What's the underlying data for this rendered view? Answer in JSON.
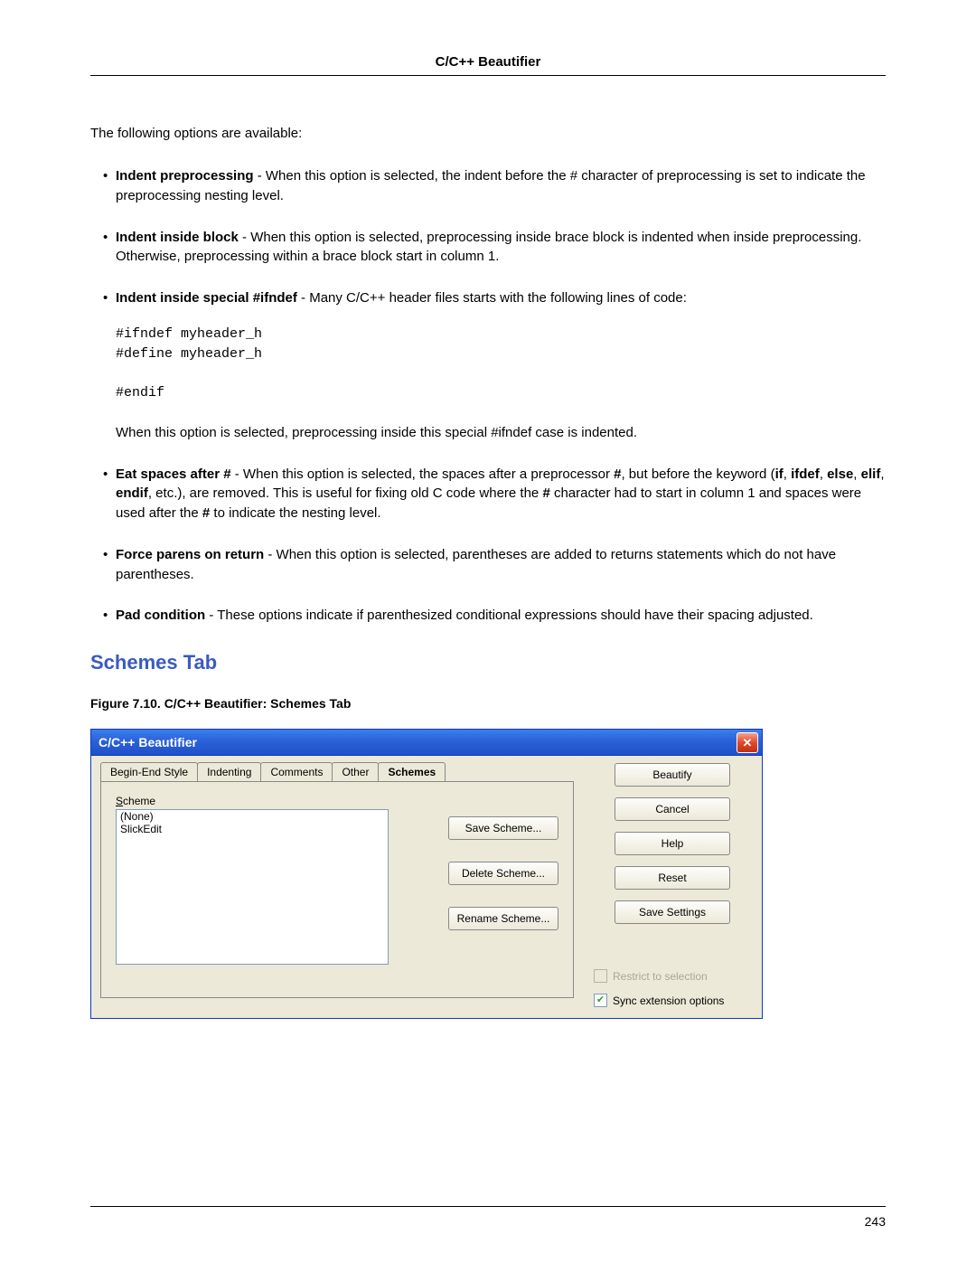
{
  "header": "C/C++ Beautifier",
  "intro": "The following options are available:",
  "bullets": [
    {
      "label": "Indent preprocessing",
      "text": " - When this option is selected, the indent before the # character of preprocessing is set to indicate the preprocessing nesting level."
    },
    {
      "label": "Indent inside block",
      "text": " - When this option is selected, preprocessing inside brace block is indented when inside preprocessing. Otherwise, preprocessing within a brace block start in column 1."
    },
    {
      "label": "Indent inside special #ifndef",
      "text": " - Many C/C++ header files starts with the following lines of code:",
      "code": "#ifndef myheader_h\n#define myheader_h\n\n#endif",
      "after": "When this option is selected, preprocessing inside this special #ifndef case is indented."
    },
    {
      "label": "Eat spaces after #",
      "text_html": " - When this option is selected, the spaces after a preprocessor <b>#</b>, but before the keyword (<b>if</b>, <b>ifdef</b>, <b>else</b>, <b>elif</b>, <b>endif</b>, etc.), are removed. This is useful for fixing old C code where the <b>#</b> character had to start in column 1 and spaces were used after the <b>#</b> to indicate the nesting level."
    },
    {
      "label": "Force parens on return",
      "text": " - When this option is selected, parentheses are added to returns statements which do not have parentheses."
    },
    {
      "label": "Pad condition",
      "text": " - These options indicate if parenthesized conditional expressions should have their spacing adjusted."
    }
  ],
  "section_heading": "Schemes Tab",
  "figure_caption": "Figure 7.10. C/C++ Beautifier: Schemes Tab",
  "dialog": {
    "title": "C/C++ Beautifier",
    "tabs": [
      "Begin-End Style",
      "Indenting",
      "Comments",
      "Other",
      "Schemes"
    ],
    "active_tab": "Schemes",
    "scheme_label": "Scheme",
    "scheme_list": [
      "(None)",
      "SlickEdit"
    ],
    "scheme_buttons": [
      "Save Scheme...",
      "Delete Scheme...",
      "Rename Scheme..."
    ],
    "side_buttons": [
      "Beautify",
      "Cancel",
      "Help",
      "Reset",
      "Save Settings"
    ],
    "checks": [
      {
        "label": "Restrict to selection",
        "checked": false,
        "disabled": true
      },
      {
        "label": "Sync extension options",
        "checked": true,
        "disabled": false
      }
    ]
  },
  "page_number": "243"
}
